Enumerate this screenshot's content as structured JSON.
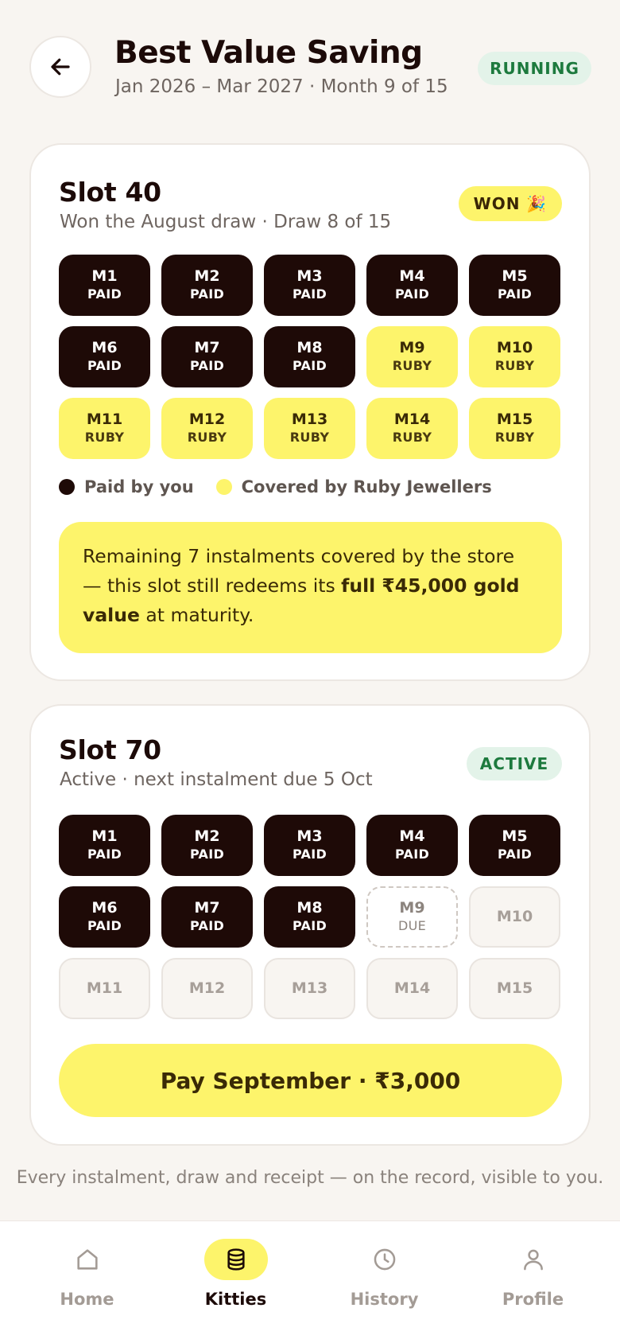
{
  "header": {
    "title": "Best Value Saving",
    "subtitle": "Jan 2026 – Mar 2027 · Month 9 of 15",
    "status": "RUNNING"
  },
  "slot40": {
    "title": "Slot 40",
    "subtitle": "Won the August draw · Draw 8 of 15",
    "badge": "WON 🎉",
    "months": [
      {
        "m": "M1",
        "s": "PAID",
        "state": "paid"
      },
      {
        "m": "M2",
        "s": "PAID",
        "state": "paid"
      },
      {
        "m": "M3",
        "s": "PAID",
        "state": "paid"
      },
      {
        "m": "M4",
        "s": "PAID",
        "state": "paid"
      },
      {
        "m": "M5",
        "s": "PAID",
        "state": "paid"
      },
      {
        "m": "M6",
        "s": "PAID",
        "state": "paid"
      },
      {
        "m": "M7",
        "s": "PAID",
        "state": "paid"
      },
      {
        "m": "M8",
        "s": "PAID",
        "state": "paid"
      },
      {
        "m": "M9",
        "s": "RUBY",
        "state": "ruby"
      },
      {
        "m": "M10",
        "s": "RUBY",
        "state": "ruby"
      },
      {
        "m": "M11",
        "s": "RUBY",
        "state": "ruby"
      },
      {
        "m": "M12",
        "s": "RUBY",
        "state": "ruby"
      },
      {
        "m": "M13",
        "s": "RUBY",
        "state": "ruby"
      },
      {
        "m": "M14",
        "s": "RUBY",
        "state": "ruby"
      },
      {
        "m": "M15",
        "s": "RUBY",
        "state": "ruby"
      }
    ],
    "legend_paid": "Paid by you",
    "legend_covered": "Covered by Ruby Jewellers",
    "notice_pre": "Remaining 7 instalments covered by the store — this slot still redeems its ",
    "notice_bold": "full ₹45,000 gold value",
    "notice_post": " at maturity."
  },
  "slot70": {
    "title": "Slot 70",
    "subtitle": "Active · next instalment due 5 Oct",
    "badge": "ACTIVE",
    "months": [
      {
        "m": "M1",
        "s": "PAID",
        "state": "paid"
      },
      {
        "m": "M2",
        "s": "PAID",
        "state": "paid"
      },
      {
        "m": "M3",
        "s": "PAID",
        "state": "paid"
      },
      {
        "m": "M4",
        "s": "PAID",
        "state": "paid"
      },
      {
        "m": "M5",
        "s": "PAID",
        "state": "paid"
      },
      {
        "m": "M6",
        "s": "PAID",
        "state": "paid"
      },
      {
        "m": "M7",
        "s": "PAID",
        "state": "paid"
      },
      {
        "m": "M8",
        "s": "PAID",
        "state": "paid"
      },
      {
        "m": "M9",
        "s": "DUE",
        "state": "due"
      },
      {
        "m": "M10",
        "s": "",
        "state": "future"
      },
      {
        "m": "M11",
        "s": "",
        "state": "future"
      },
      {
        "m": "M12",
        "s": "",
        "state": "future"
      },
      {
        "m": "M13",
        "s": "",
        "state": "future"
      },
      {
        "m": "M14",
        "s": "",
        "state": "future"
      },
      {
        "m": "M15",
        "s": "",
        "state": "future"
      }
    ],
    "pay_label": "Pay September · ₹3,000"
  },
  "footer_note": "Every instalment, draw and receipt — on the record, visible to you.",
  "nav": {
    "items": [
      {
        "label": "Home",
        "icon": "home-icon"
      },
      {
        "label": "Kitties",
        "icon": "coins-icon"
      },
      {
        "label": "History",
        "icon": "clock-icon"
      },
      {
        "label": "Profile",
        "icon": "user-icon"
      }
    ],
    "active": "Kitties"
  },
  "colors": {
    "accent_yellow": "#fdf46b",
    "dark": "#1e0a07",
    "running_green": "#1d7a3e"
  }
}
